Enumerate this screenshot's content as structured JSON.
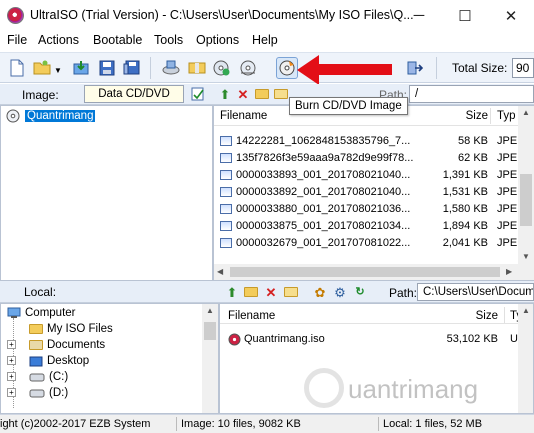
{
  "window": {
    "title": "UltraISO (Trial Version) - C:\\Users\\User\\Documents\\My ISO Files\\Q...",
    "minimize": "─",
    "maximize": "☐",
    "close": "✕"
  },
  "menu": [
    "File",
    "Actions",
    "Bootable",
    "Tools",
    "Options",
    "Help"
  ],
  "toolbar": {
    "total_size_label": "Total Size:",
    "total_size_value": "90"
  },
  "tooltip": "Burn CD/DVD Image",
  "image_pane": {
    "label": "Image:",
    "type_value": "Data CD/DVD",
    "path_label": "Path:",
    "path_value": "/",
    "tree_root": "Quantrimang"
  },
  "image_files": {
    "headers": [
      "Filename",
      "Size",
      "Typ"
    ],
    "rows": [
      {
        "name": "14222281_1062848153835796_7...",
        "size": "58 KB",
        "type": "JPE"
      },
      {
        "name": "135f7826f3e59aaa9a782d9e99f78...",
        "size": "62 KB",
        "type": "JPE"
      },
      {
        "name": "0000033893_001_201708021040...",
        "size": "1,391 KB",
        "type": "JPE"
      },
      {
        "name": "0000033892_001_201708021040...",
        "size": "1,531 KB",
        "type": "JPE"
      },
      {
        "name": "0000033880_001_201708021036...",
        "size": "1,580 KB",
        "type": "JPE"
      },
      {
        "name": "0000033875_001_201708021034...",
        "size": "1,894 KB",
        "type": "JPE"
      },
      {
        "name": "0000032679_001_201707081022...",
        "size": "2,041 KB",
        "type": "JPE"
      }
    ]
  },
  "local_pane": {
    "label": "Local:",
    "path_label": "Path:",
    "path_value": "C:\\Users\\User\\Docume",
    "tree": [
      "Computer",
      "My ISO Files",
      "Documents",
      "Desktop",
      "(C:)",
      "(D:)"
    ]
  },
  "local_files": {
    "headers": [
      "Filename",
      "Size",
      "Type"
    ],
    "rows": [
      {
        "name": "Quantrimang.iso",
        "size": "53,102 KB",
        "type": "Ultra"
      }
    ]
  },
  "status": {
    "copyright": "ight (c)2002-2017 EZB System",
    "image_info": "Image: 10 files, 9082 KB",
    "local_info": "Local: 1 files, 52 MB"
  },
  "watermark": "uantrimang",
  "colors": {
    "accent_arrow": "#e30e16",
    "toolbar_bg": "#eef3fa",
    "selection": "#0078d7"
  }
}
